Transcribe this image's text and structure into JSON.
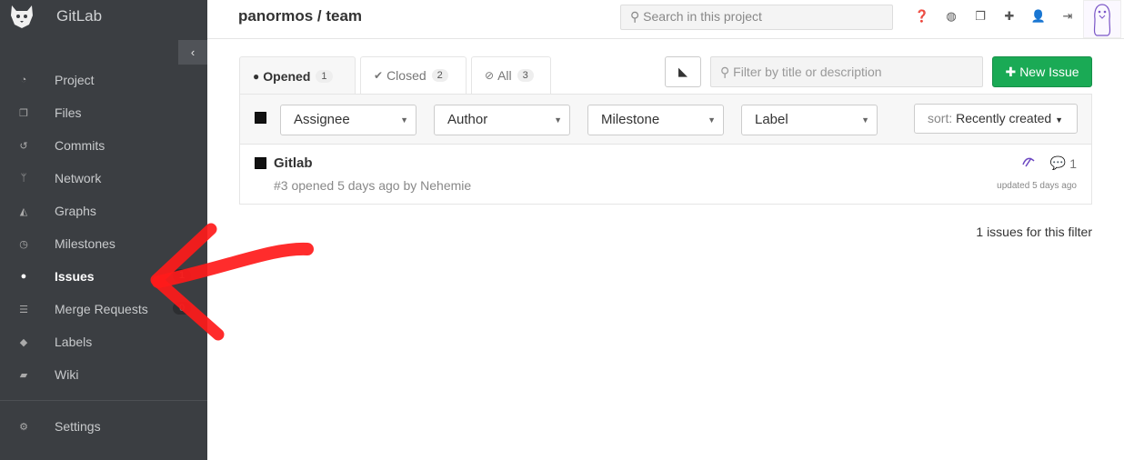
{
  "app": {
    "name": "GitLab"
  },
  "sidebar": {
    "items": [
      {
        "label": "Project",
        "icon": "dashboard-icon"
      },
      {
        "label": "Files",
        "icon": "files-icon"
      },
      {
        "label": "Commits",
        "icon": "history-icon"
      },
      {
        "label": "Network",
        "icon": "code-fork-icon"
      },
      {
        "label": "Graphs",
        "icon": "area-chart-icon"
      },
      {
        "label": "Milestones",
        "icon": "clock-icon"
      },
      {
        "label": "Issues",
        "icon": "exclamation-circle-icon",
        "active": true,
        "count": "1"
      },
      {
        "label": "Merge Requests",
        "icon": "tasks-icon",
        "count": "0"
      },
      {
        "label": "Labels",
        "icon": "tags-icon"
      },
      {
        "label": "Wiki",
        "icon": "book-icon"
      }
    ],
    "settings": {
      "label": "Settings",
      "icon": "cogs-icon"
    }
  },
  "header": {
    "project_title": "panormos / team",
    "search_placeholder": "Search in this project",
    "icons": [
      "question-circle-icon",
      "globe-icon",
      "copy-icon",
      "plus-icon",
      "user-icon",
      "sign-out-icon"
    ]
  },
  "tabs": [
    {
      "label": "Opened",
      "count": "1",
      "icon": "exclamation-circle-icon",
      "active": true
    },
    {
      "label": "Closed",
      "count": "2",
      "icon": "check-circle-icon"
    },
    {
      "label": "All",
      "count": "3",
      "icon": "compass-icon"
    }
  ],
  "toolbar": {
    "filter_placeholder": "Filter by title or description",
    "new_issue_label": "New Issue"
  },
  "filters": {
    "assignee": "Assignee",
    "author": "Author",
    "milestone": "Milestone",
    "label": "Label",
    "sort_prefix": "sort:",
    "sort_value": "Recently created"
  },
  "issues": [
    {
      "title": "Gitlab",
      "meta": "#3 opened 5 days ago by Nehemie",
      "comments": "1",
      "updated": "updated 5 days ago"
    }
  ],
  "footer": {
    "count_text": "1 issues for this filter"
  },
  "colors": {
    "sidebar_bg": "#3b3e42",
    "accent_green": "#1aaa55",
    "annotation_red": "#ff0000"
  }
}
